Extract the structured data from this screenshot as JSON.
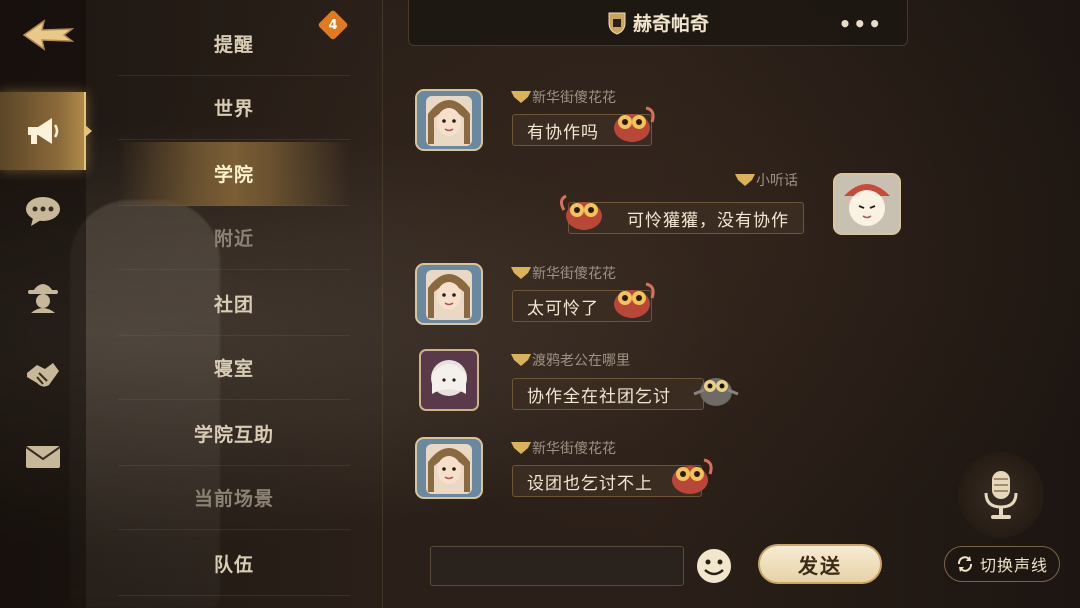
{
  "header": {
    "title": "赫奇帕奇"
  },
  "channels": [
    {
      "label": "提醒",
      "badge": "4"
    },
    {
      "label": "世界"
    },
    {
      "label": "学院"
    },
    {
      "label": "附近"
    },
    {
      "label": "社团"
    },
    {
      "label": "寝室"
    },
    {
      "label": "学院互助"
    },
    {
      "label": "当前场景"
    },
    {
      "label": "队伍"
    }
  ],
  "rail": {
    "items": [
      {
        "icon": "megaphone-icon",
        "active": true
      },
      {
        "icon": "chat-bubble-icon"
      },
      {
        "icon": "detective-hat-icon"
      },
      {
        "icon": "handshake-icon"
      },
      {
        "icon": "mail-icon"
      }
    ]
  },
  "messages": [
    {
      "sender": "新华街傻花花",
      "text": "有协作吗",
      "side": "left"
    },
    {
      "sender": "小听话",
      "text": "可怜獾獾，没有协作",
      "side": "right"
    },
    {
      "sender": "新华街傻花花",
      "text": "太可怜了",
      "side": "left"
    },
    {
      "sender": "渡鸦老公在哪里",
      "text": "协作全在社团乞讨",
      "side": "left"
    },
    {
      "sender": "新华街傻花花",
      "text": "设团也乞讨不上",
      "side": "left"
    }
  ],
  "composer": {
    "send_label": "发送",
    "switch_label": "切换声线"
  },
  "colors": {
    "accent_gold": "#e6c27a",
    "badge_orange": "#e07a1e",
    "bubble_bg": "#3a2c20"
  }
}
